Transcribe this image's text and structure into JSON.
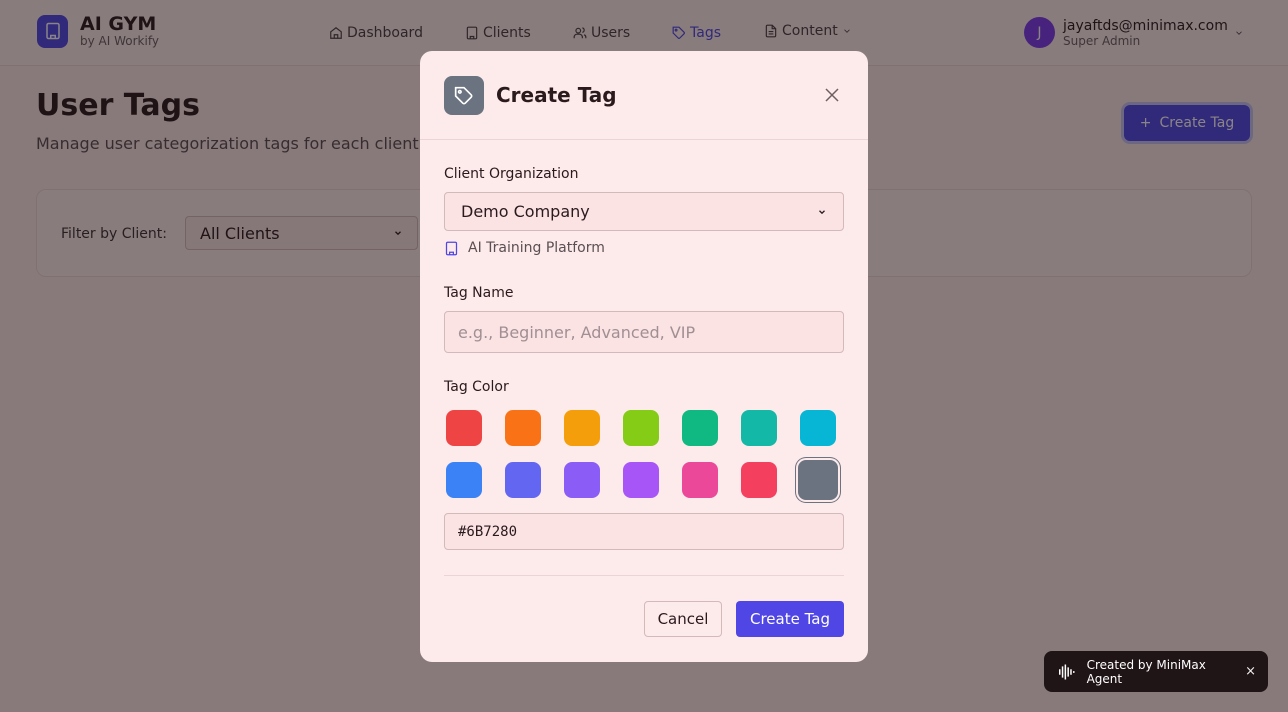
{
  "header": {
    "brand_title": "AI GYM",
    "brand_subtitle": "by AI Workify",
    "nav": [
      {
        "label": "Dashboard",
        "icon": "home-icon"
      },
      {
        "label": "Clients",
        "icon": "building-icon"
      },
      {
        "label": "Users",
        "icon": "users-icon"
      },
      {
        "label": "Tags",
        "icon": "tag-icon",
        "active": true
      },
      {
        "label": "Content",
        "icon": "document-icon",
        "has_dropdown": true
      }
    ],
    "user": {
      "initial": "J",
      "email": "jayaftds@minimax.com",
      "role": "Super Admin"
    }
  },
  "page": {
    "title": "User Tags",
    "subtitle": "Manage user categorization tags for each client",
    "create_button_label": "Create Tag",
    "filter": {
      "label": "Filter by Client:",
      "selected": "All Clients"
    }
  },
  "modal": {
    "title": "Create Tag",
    "client_label": "Client Organization",
    "client_selected": "Demo Company",
    "client_subtitle": "AI Training Platform",
    "tag_name_label": "Tag Name",
    "tag_name_placeholder": "e.g., Beginner, Advanced, VIP",
    "tag_name_value": "",
    "tag_color_label": "Tag Color",
    "colors": [
      "#EF4444",
      "#F97316",
      "#F59E0B",
      "#84CC16",
      "#10B981",
      "#14B8A6",
      "#06B6D4",
      "#3B82F6",
      "#6366F1",
      "#8B5CF6",
      "#A855F7",
      "#EC4899",
      "#F43F5E",
      "#6B7280"
    ],
    "selected_color": "#6B7280",
    "hex_value": "#6B7280",
    "cancel_label": "Cancel",
    "submit_label": "Create Tag"
  },
  "toast": {
    "text": "Created by MiniMax Agent",
    "close": "×"
  },
  "colors": {
    "accent": "#4f46e5",
    "avatar": "#7c3aed"
  }
}
